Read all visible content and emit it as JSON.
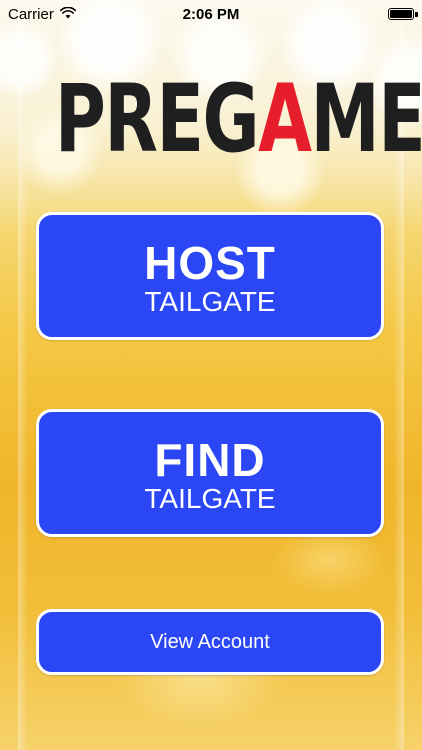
{
  "status_bar": {
    "carrier": "Carrier",
    "time": "2:06 PM",
    "wifi_icon": "wifi-icon",
    "battery_icon": "battery-icon",
    "battery_level": 1.0
  },
  "logo": {
    "part1": "PREG",
    "part2": "A",
    "part3": "ME",
    "accent_color": "#e61d2a",
    "text_color": "#1f1f1f"
  },
  "buttons": {
    "host": {
      "title": "HOST",
      "subtitle": "TAILGATE"
    },
    "find": {
      "title": "FIND",
      "subtitle": "TAILGATE"
    },
    "account": {
      "label": "View Account"
    }
  },
  "colors": {
    "button_bg": "#2b46f5",
    "button_border": "#ffffff",
    "beer": "#f4c743"
  }
}
